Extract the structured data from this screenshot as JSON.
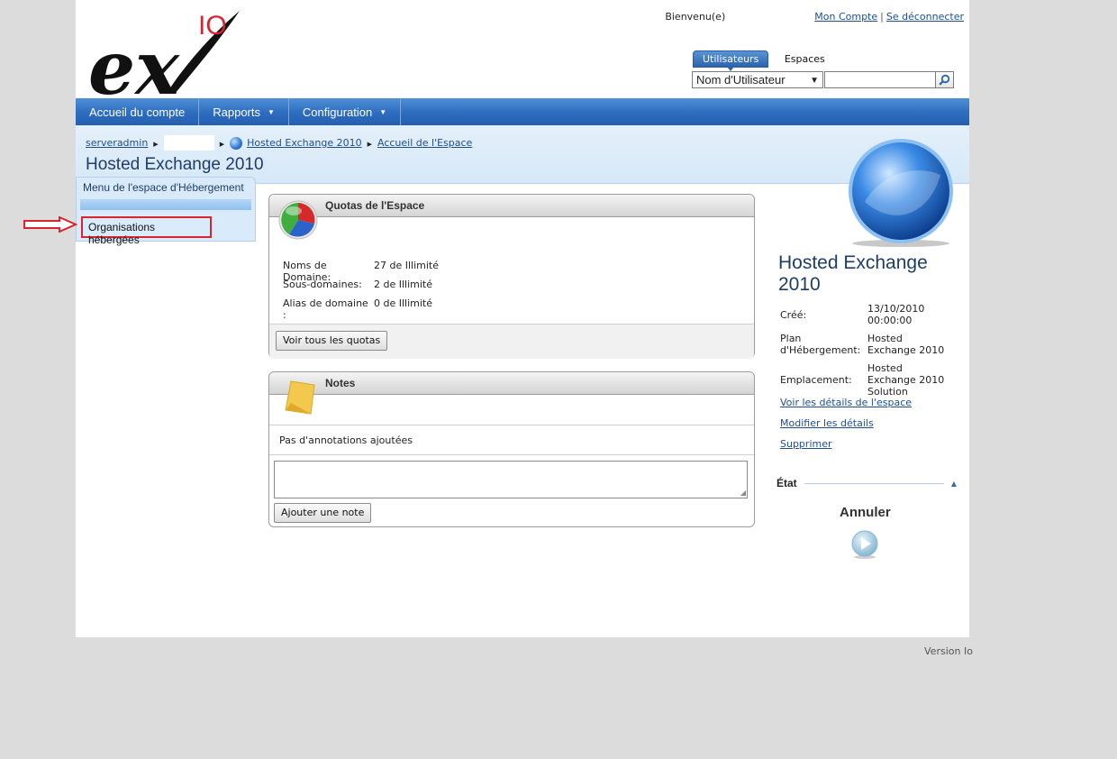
{
  "header": {
    "welcome_label": "Bienvenu(e)",
    "my_account": "Mon Compte",
    "separator": "|",
    "logout": "Se déconnecter",
    "logo_text": "ex",
    "logo_superscript": "IO"
  },
  "search": {
    "tabs": [
      {
        "label": "Utilisateurs",
        "active": true
      },
      {
        "label": "Espaces",
        "active": false
      }
    ],
    "select_value": "Nom d'Utilisateur",
    "input_value": ""
  },
  "nav": {
    "items": [
      {
        "label": "Accueil du compte",
        "dropdown": false
      },
      {
        "label": "Rapports",
        "dropdown": true
      },
      {
        "label": "Configuration",
        "dropdown": true
      }
    ]
  },
  "breadcrumb": {
    "items": [
      "serveradmin",
      "Hosted Exchange 2010",
      "Accueil de l'Espace"
    ]
  },
  "page_title": "Hosted Exchange 2010",
  "left_menu": {
    "title": "Menu de l'espace d'Hébergement",
    "items": [
      "Organisations hébergées"
    ]
  },
  "quotas": {
    "title": "Quotas de l'Espace",
    "rows": [
      {
        "label": "Noms de Domaine:",
        "value": "27 de Illimité"
      },
      {
        "label": "Sous-domaines:",
        "value": "2 de Illimité"
      },
      {
        "label": "Alias de domaine :",
        "value": "0 de Illimité"
      }
    ],
    "button": "Voir tous les quotas"
  },
  "notes": {
    "title": "Notes",
    "empty_text": "Pas d'annotations ajoutées",
    "textarea_value": "",
    "button": "Ajouter une note"
  },
  "sidebar": {
    "title": "Hosted Exchange 2010",
    "info": [
      {
        "key": "Créé:",
        "value": "13/10/2010 00:00:00"
      },
      {
        "key": "Plan d'Hébergement:",
        "value": "Hosted Exchange 2010"
      },
      {
        "key": "Emplacement:",
        "value": "Hosted Exchange 2010 Solution"
      }
    ],
    "links": [
      "Voir les détails de l'espace",
      "Modifier les détails",
      "Supprimer"
    ],
    "state_label": "État",
    "cancel_label": "Annuler"
  },
  "footer": {
    "version": "Version Io"
  },
  "colors": {
    "nav_blue": "#2d6cbf",
    "title_blue": "#1e3d66",
    "highlight_red": "#d9232e",
    "link_blue": "#1f4e8c"
  }
}
